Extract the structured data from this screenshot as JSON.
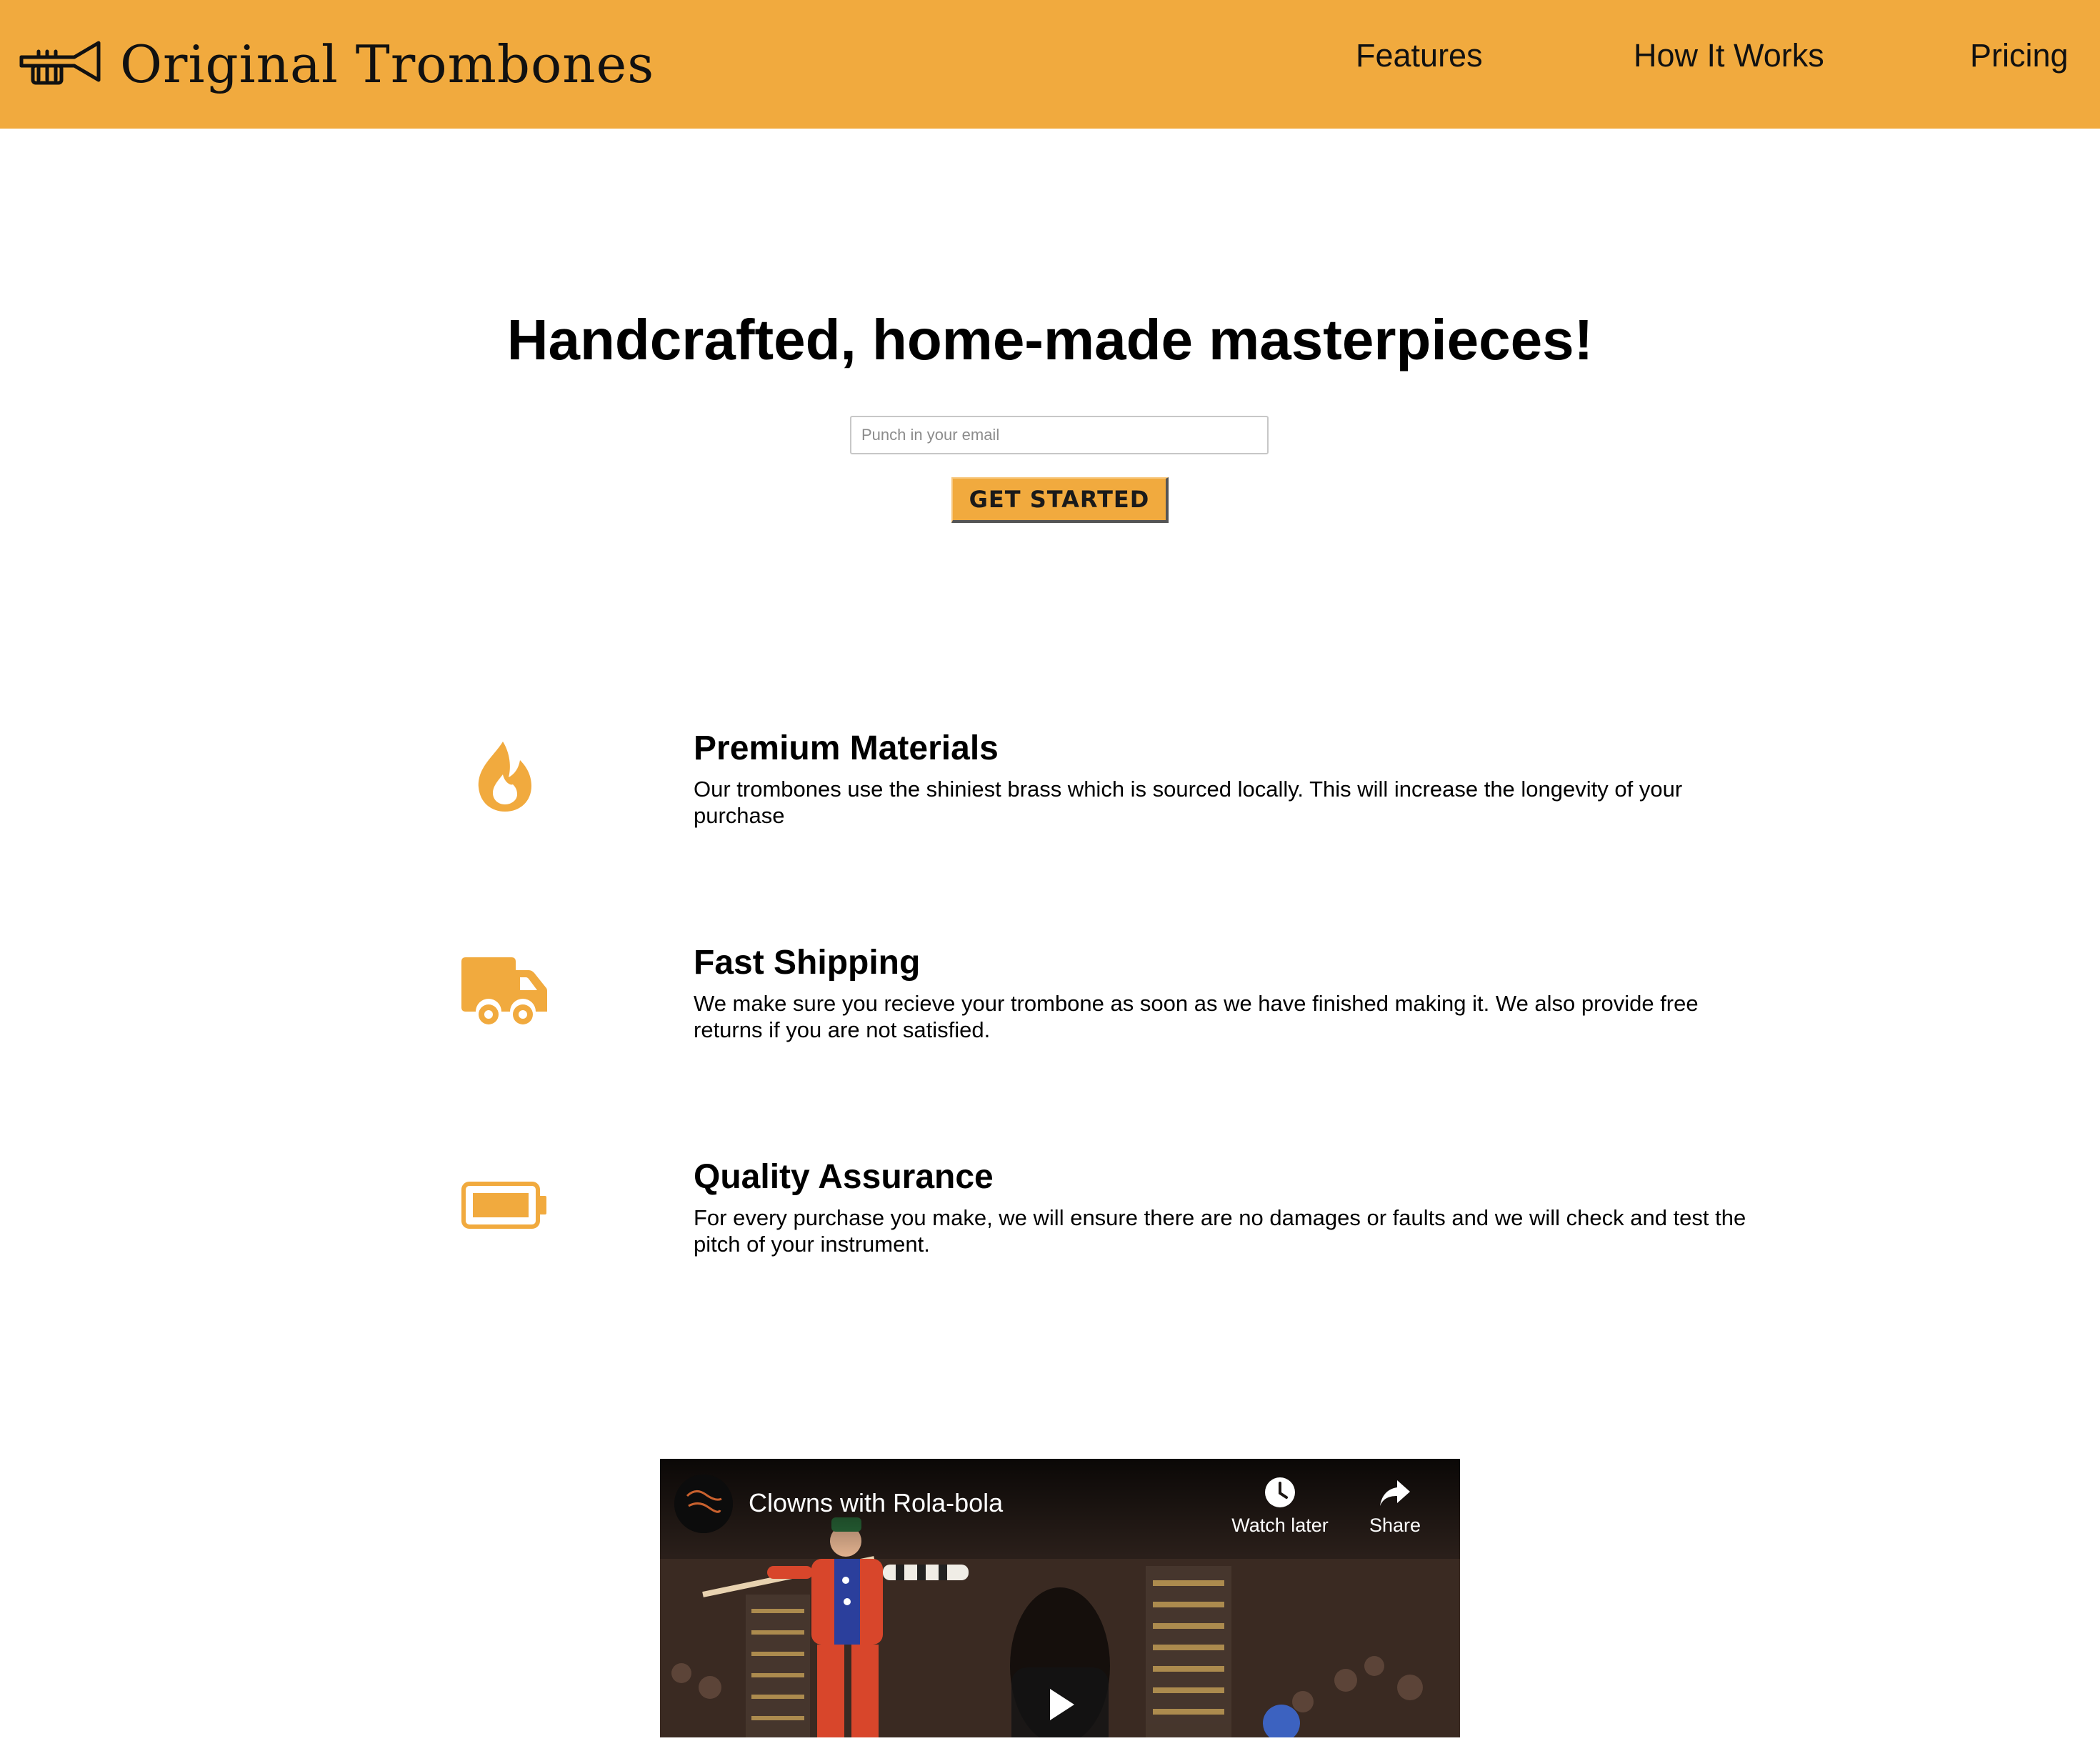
{
  "header": {
    "brand": "Original Trombones",
    "nav": [
      {
        "label": "Features"
      },
      {
        "label": "How It Works"
      },
      {
        "label": "Pricing"
      }
    ]
  },
  "hero": {
    "title": "Handcrafted, home-made masterpieces!",
    "email_placeholder": "Punch in your email",
    "email_value": "",
    "cta_label": "GET STARTED"
  },
  "features": [
    {
      "icon": "fire-icon",
      "title": "Premium Materials",
      "description": "Our trombones use the shiniest brass which is sourced locally. This will increase the longevity of your purchase"
    },
    {
      "icon": "truck-icon",
      "title": "Fast Shipping",
      "description": "We make sure you recieve your trombone as soon as we have finished making it. We also provide free returns if you are not satisfied."
    },
    {
      "icon": "battery-full-icon",
      "title": "Quality Assurance",
      "description": "For every purchase you make, we will ensure there are no damages or faults and we will check and test the pitch of your instrument."
    }
  ],
  "video": {
    "title": "Clowns with Rola-bola",
    "watch_later_label": "Watch later",
    "share_label": "Share",
    "icons": [
      "clock-icon",
      "share-arrow-icon",
      "play-icon"
    ]
  },
  "colors": {
    "accent": "#f1aa3e",
    "text": "#000000",
    "background": "#ffffff"
  }
}
